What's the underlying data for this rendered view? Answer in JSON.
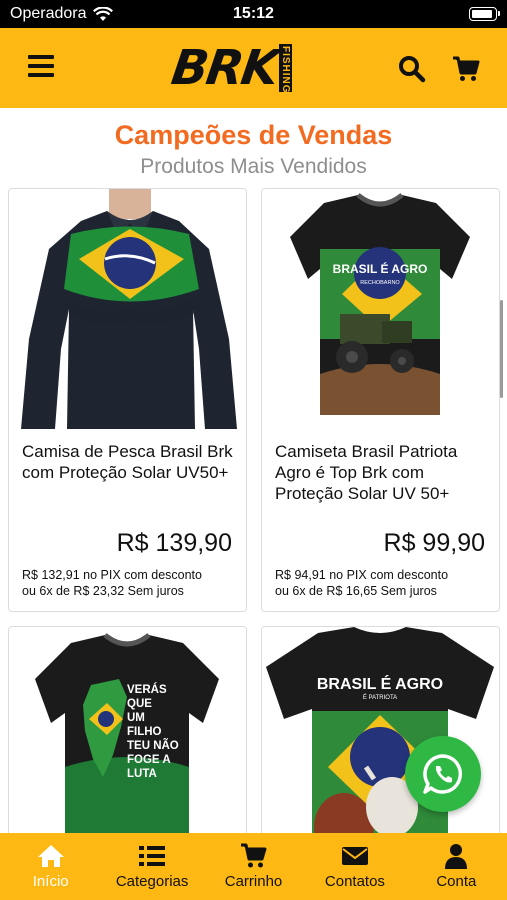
{
  "status_bar": {
    "carrier": "Operadora",
    "time": "15:12",
    "battery_level": 0.9
  },
  "header": {
    "logo_text": "BRK",
    "logo_subtext": "FISHING",
    "icons": [
      "menu-icon",
      "search-icon",
      "cart-icon"
    ]
  },
  "section": {
    "title": "Campeões de Vendas",
    "subtitle": "Produtos Mais Vendidos"
  },
  "products": [
    {
      "name": "Camisa de Pesca Brasil Brk com Proteção Solar UV50+",
      "price": "R$ 139,90",
      "pix": "R$ 132,91 no PIX com desconto",
      "installments": "ou 6x de R$ 23,32 Sem juros"
    },
    {
      "name": "Camiseta Brasil Patriota Agro é Top Brk com Proteção Solar UV 50+",
      "price": "R$ 99,90",
      "pix": "R$ 94,91 no PIX com desconto",
      "installments": "ou 6x de R$ 16,65 Sem juros",
      "print_text": "BRASIL É AGRO",
      "print_subtext": "RECHOBARNO"
    },
    {
      "print_lines": [
        "VERÁS",
        "QUE",
        "UM",
        "FILHO",
        "TEU NÃO",
        "FOGE A",
        "LUTA"
      ]
    },
    {
      "print_text": "BRASIL É AGRO",
      "print_subtext": "É PATRIOTA"
    }
  ],
  "bottom_nav": {
    "items": [
      {
        "label": "Início",
        "icon": "home-icon",
        "active": true
      },
      {
        "label": "Categorias",
        "icon": "list-icon",
        "active": false
      },
      {
        "label": "Carrinho",
        "icon": "cart-icon",
        "active": false
      },
      {
        "label": "Contatos",
        "icon": "envelope-icon",
        "active": false
      },
      {
        "label": "Conta",
        "icon": "user-icon",
        "active": false
      }
    ]
  },
  "colors": {
    "brand_yellow": "#FDB813",
    "title_orange": "#F26B21",
    "whatsapp_green": "#2FB944"
  }
}
